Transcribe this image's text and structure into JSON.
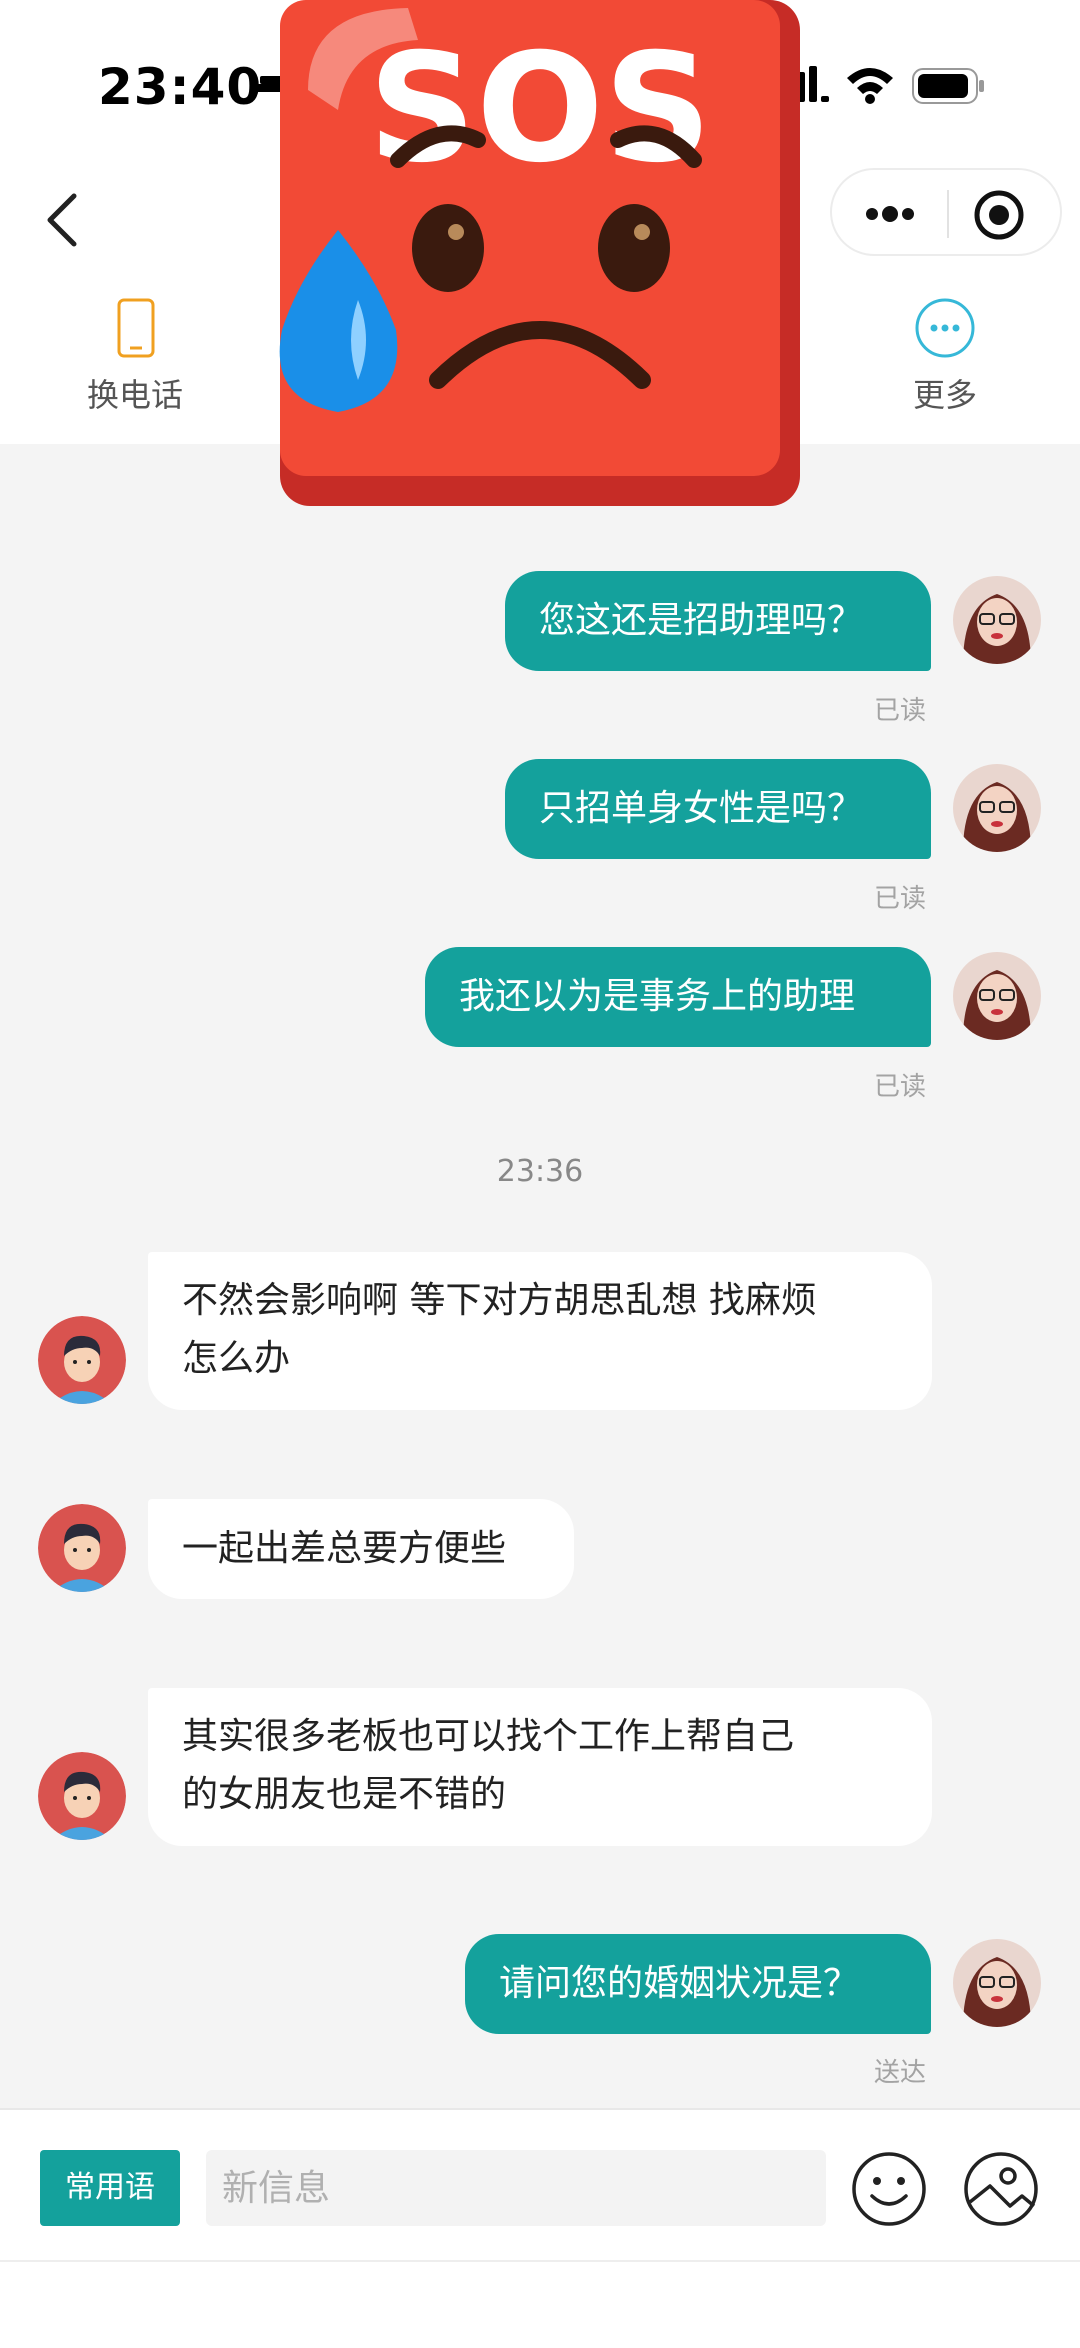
{
  "status_bar": {
    "time": "23:40"
  },
  "actions": {
    "phone": {
      "label": "换电话",
      "icon": "phone-icon",
      "color": "#f0a020"
    },
    "more": {
      "label": "更多",
      "icon": "more-dots-icon",
      "color": "#36b8d8"
    }
  },
  "sticker": {
    "text": "SOS",
    "icon": "sos-sad-face-sticker"
  },
  "colors": {
    "accent": "#14a19c",
    "background": "#f4f4f4"
  },
  "messages": [
    {
      "side": "sent",
      "text": "您这还是招助理吗？",
      "status": "已读"
    },
    {
      "side": "sent",
      "text": "只招单身女性是吗？",
      "status": "已读"
    },
    {
      "side": "sent",
      "text": "我还以为是事务上的助理",
      "status": "已读"
    },
    {
      "side": "recv",
      "text_line1": "不然会影响啊 等下对方胡思乱想 找麻烦",
      "text_line2": "怎么办"
    },
    {
      "side": "recv",
      "text": "一起出差总要方便些"
    },
    {
      "side": "recv",
      "text_line1": "其实很多老板也可以找个工作上帮自己",
      "text_line2": "的女朋友也是不错的"
    },
    {
      "side": "sent",
      "text": "请问您的婚姻状况是？",
      "status": "送达"
    }
  ],
  "timestamp": "23:36",
  "input": {
    "quick_phrases_label": "常用语",
    "placeholder": "新信息"
  }
}
